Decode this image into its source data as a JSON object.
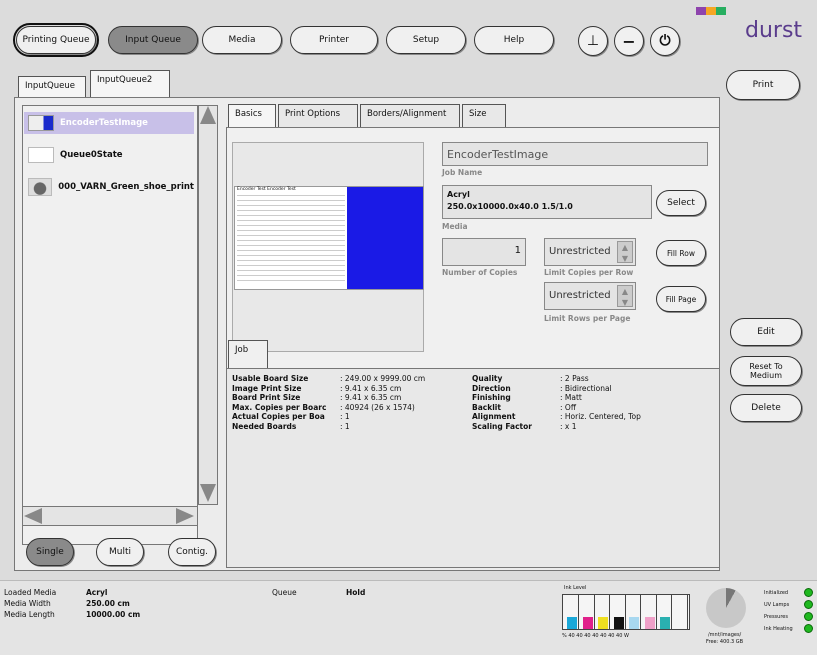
{
  "top_nav": {
    "printing_queue": "Printing Queue",
    "input_queue": "Input Queue",
    "media": "Media",
    "printer": "Printer",
    "setup": "Setup",
    "help": "Help"
  },
  "brand": {
    "name": "durst",
    "colors": [
      "#8e44ad",
      "#f5a623",
      "#27ae60"
    ]
  },
  "queue_tabs": [
    "InputQueue",
    "InputQueue2"
  ],
  "job_list": [
    {
      "name": "EncoderTestImage",
      "selected": true
    },
    {
      "name": "Queue0State",
      "selected": false
    },
    {
      "name": "000_VARN_Green_shoe_print",
      "selected": false
    }
  ],
  "mode_buttons": {
    "single": "Single",
    "multi": "Multi",
    "contig": "Contig."
  },
  "detail_tabs": [
    "Basics",
    "Print Options",
    "Borders/Alignment",
    "Size"
  ],
  "job": {
    "name": "EncoderTestImage",
    "name_label": "Job Name",
    "media_line1": "Acryl",
    "media_line2": "250.0x10000.0x40.0 1.5/1.0",
    "media_label": "Media",
    "select_button": "Select",
    "copies": "1",
    "copies_label": "Number of Copies",
    "limit_copies": "Unrestricted",
    "limit_copies_label": "Limit Copies per Row",
    "fill_row": "Fill Row",
    "limit_rows": "Unrestricted",
    "limit_rows_label": "Limit Rows per Page",
    "fill_page": "Fill Page",
    "preview_caption": "Encoder Test Encoder Test"
  },
  "job_tab": "Job",
  "info_left": [
    {
      "key": "Usable Board Size",
      "value": ": 249.00 x 9999.00 cm"
    },
    {
      "key": "Image Print Size",
      "value": ": 9.41 x 6.35 cm"
    },
    {
      "key": "Board Print Size",
      "value": ": 9.41 x 6.35 cm"
    },
    {
      "key": "Max. Copies per Boarc",
      "value": ": 40924 (26 x 1574)"
    },
    {
      "key": "Actual Copies per Boa",
      "value": ": 1"
    },
    {
      "key": "Needed Boards",
      "value": ": 1"
    }
  ],
  "info_right": [
    {
      "key": "Quality",
      "value": ": 2 Pass"
    },
    {
      "key": "Direction",
      "value": ": Bidirectional"
    },
    {
      "key": "Finishing",
      "value": ": Matt"
    },
    {
      "key": "Backlit",
      "value": ": Off"
    },
    {
      "key": "Alignment",
      "value": ": Horiz. Centered, Top"
    },
    {
      "key": "Scaling Factor",
      "value": ": x 1"
    }
  ],
  "right_buttons": {
    "print": "Print",
    "edit": "Edit",
    "reset": "Reset To Medium",
    "delete": "Delete"
  },
  "status": {
    "loaded_media_label": "Loaded Media",
    "loaded_media": "Acryl",
    "media_width_label": "Media Width",
    "media_width": "250.00 cm",
    "media_length_label": "Media Length",
    "media_length": "10000.00 cm",
    "queue_label": "Queue",
    "queue_value": "Hold",
    "ink_level_label": "Ink Level",
    "ink_ticks": "% 40 40 40 40 40 40 40 W",
    "disk_label": "/mnt/images/",
    "disk_free": "Free: 400.3 GB",
    "indicators": [
      "Initialized",
      "UV Lamps",
      "Pressures",
      "Ink Heating"
    ]
  },
  "ink_levels": [
    {
      "color": "#1aa8d8",
      "level": 0.35
    },
    {
      "color": "#e0208a",
      "level": 0.35
    },
    {
      "color": "#f0e020",
      "level": 0.35
    },
    {
      "color": "#111111",
      "level": 0.35
    },
    {
      "color": "#a8d8f0",
      "level": 0.35
    },
    {
      "color": "#f0a0c8",
      "level": 0.35
    },
    {
      "color": "#2ab0b0",
      "level": 0.35
    },
    {
      "color": "#ffffff",
      "level": 0.0
    }
  ]
}
